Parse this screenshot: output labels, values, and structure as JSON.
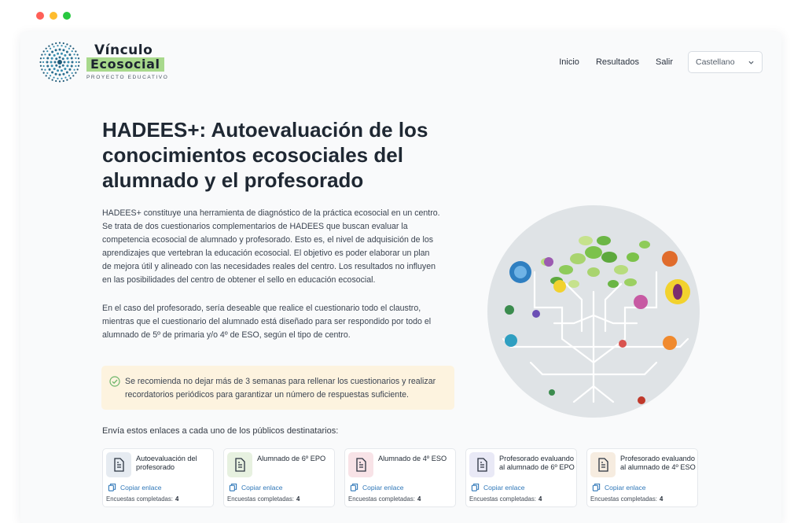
{
  "window": {
    "controls": [
      "close",
      "minimize",
      "maximize"
    ]
  },
  "header": {
    "logo": {
      "line1": "Vínculo",
      "line2": "Ecosocial",
      "sub": "PROYECTO EDUCATIVO"
    },
    "nav": [
      {
        "label": "Inicio"
      },
      {
        "label": "Resultados"
      },
      {
        "label": "Salir"
      }
    ],
    "language": {
      "selected": "Castellano",
      "icon": "chevron-down-icon"
    }
  },
  "main": {
    "title": "HADEES+: Autoevaluación de los conocimientos ecosociales del alumnado y el profesorado",
    "paragraph1": "HADEES+ constituye una herramienta de diagnóstico de la práctica ecosocial en un centro. Se trata de dos cuestionarios complementarios de HADEES que buscan evaluar la competencia ecosocial de alumnado y profesorado. Esto es, el nivel de adquisición de los aprendizajes que vertebran la educación ecosocial. El objetivo es poder elaborar un plan de mejora útil y alineado con las necesidades reales del centro. Los resultados no influyen en las posibilidades del centro de obtener el sello en educación ecosocial.",
    "paragraph2": "En el caso del profesorado, sería deseable que realice el cuestionario todo el claustro, mientras que el cuestionario del alumnado está diseñado para ser respondido por todo el alumnado de 5º de primaria y/o 4º de ESO, según el tipo de centro.",
    "notice": "Se recomienda no dejar más de 3 semanas para rellenar los cuestionarios y realizar recordatorios periódicos para garantizar un número de respuestas suficiente.",
    "send_label": "Envía estos enlaces a cada uno de los públicos destinatarios:",
    "cards": [
      {
        "title": "Autoevaluación del profesorado",
        "copy": "Copiar enlace",
        "counter_label": "Encuestas completadas:",
        "count": "4",
        "color": "#e6ebf1"
      },
      {
        "title": "Alumnado de 6º EPO",
        "copy": "Copiar enlace",
        "counter_label": "Encuestas completadas:",
        "count": "4",
        "color": "#e7f1e0"
      },
      {
        "title": "Alumnado de 4º ESO",
        "copy": "Copiar enlace",
        "counter_label": "Encuestas completadas:",
        "count": "4",
        "color": "#f8e3e7"
      },
      {
        "title": "Profesorado evaluando al alumnado de 6º EPO",
        "copy": "Copiar enlace",
        "counter_label": "Encuestas completadas:",
        "count": "4",
        "color": "#e9e9f6"
      },
      {
        "title": "Profesorado evaluando al alumnado de 4º ESO",
        "copy": "Copiar enlace",
        "counter_label": "Encuestas completadas:",
        "count": "4",
        "color": "#f6ece0"
      }
    ]
  },
  "colors": {
    "accent": "#2f77b8",
    "notice_bg": "#fdf3df",
    "logo_highlight": "#a8d98c"
  }
}
